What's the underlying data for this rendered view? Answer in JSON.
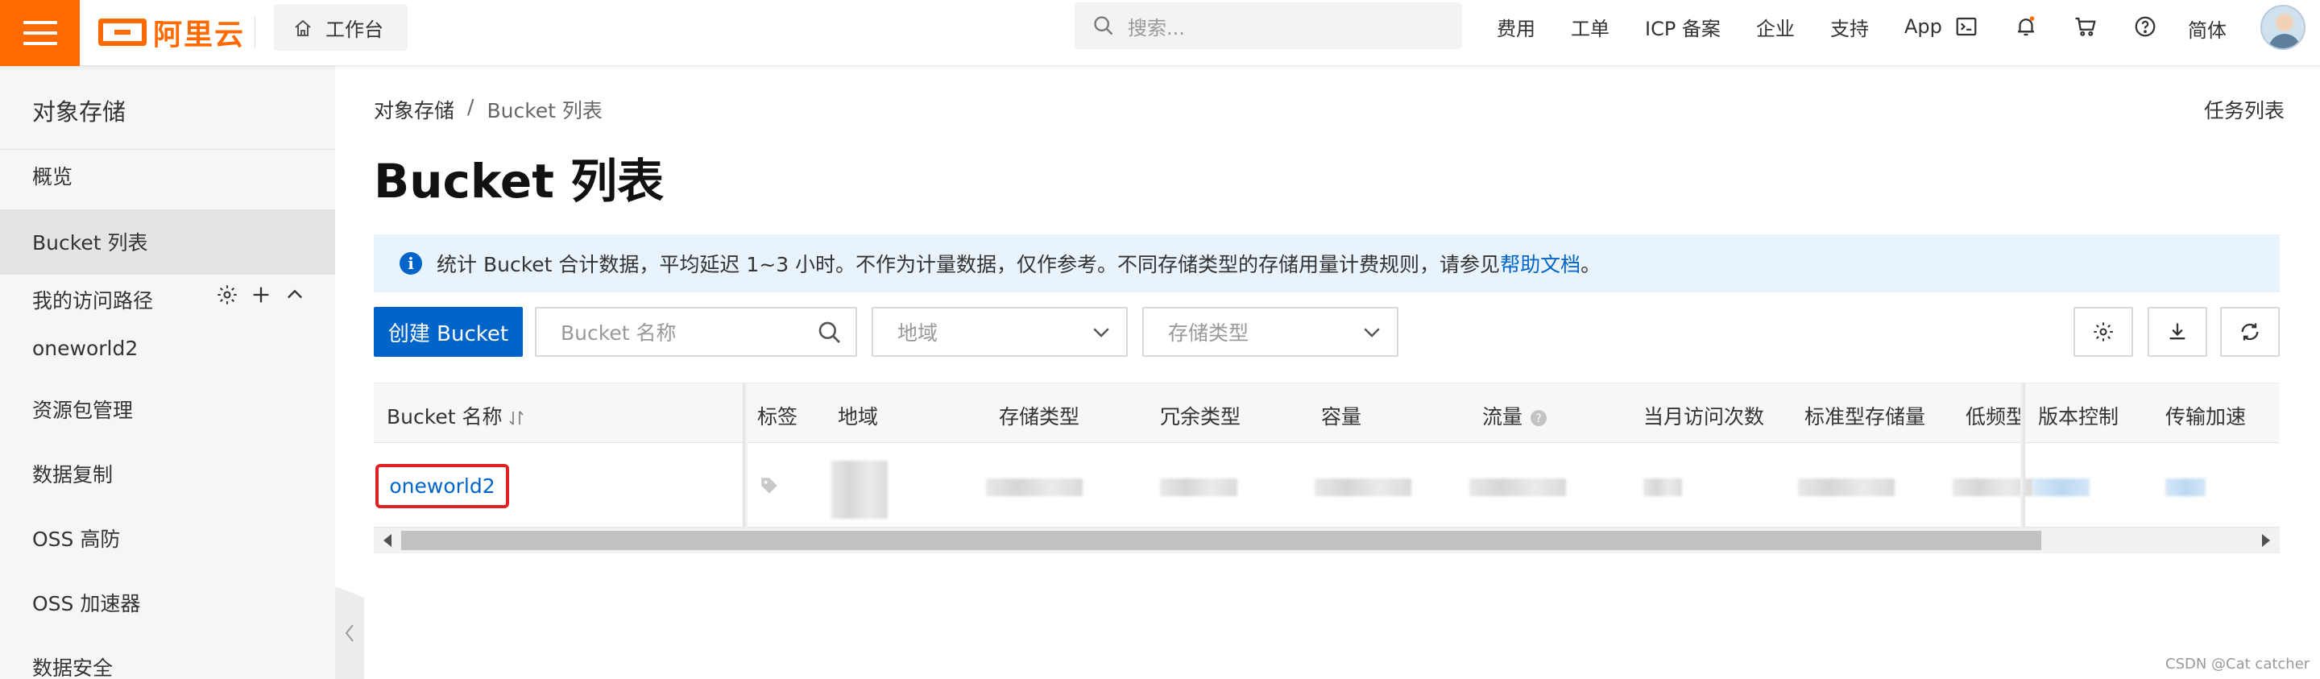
{
  "topbar": {
    "logo_text": "阿里云",
    "workbench_label": "工作台",
    "search_placeholder": "搜索...",
    "nav": [
      "费用",
      "工单",
      "ICP 备案",
      "企业",
      "支持",
      "App"
    ],
    "language": "简体",
    "accent_color": "#ff6a00"
  },
  "sidebar": {
    "title": "对象存储",
    "items": [
      "概览",
      "Bucket 列表"
    ],
    "active_item": "Bucket 列表",
    "section_title": "我的访问路径",
    "section_items": [
      "oneworld2",
      "资源包管理",
      "数据复制",
      "OSS 高防",
      "OSS 加速器",
      "数据安全"
    ]
  },
  "main": {
    "breadcrumb": [
      "对象存储",
      "/",
      "Bucket 列表"
    ],
    "task_list_label": "任务列表",
    "page_title": "Bucket 列表",
    "info_text": "统计 Bucket 合计数据，平均延迟 1~3 小时。不作为计量数据，仅作参考。不同存储类型的存储用量计费规则，请参见",
    "info_link": "帮助文档",
    "info_tail": "。",
    "create_button": "创建 Bucket",
    "bucket_name_placeholder": "Bucket 名称",
    "region_placeholder": "地域",
    "storage_type_placeholder": "存储类型",
    "primary_color": "#0064c8"
  },
  "table": {
    "columns": [
      "Bucket 名称",
      "标签",
      "地域",
      "存储类型",
      "冗余类型",
      "容量",
      "流量",
      "当月访问次数",
      "标准型存储量",
      "低频型",
      "版本控制",
      "传输加速"
    ],
    "rows": [
      {
        "bucket_name": "oneworld2"
      }
    ]
  },
  "watermark": "CSDN @Cat catcher"
}
